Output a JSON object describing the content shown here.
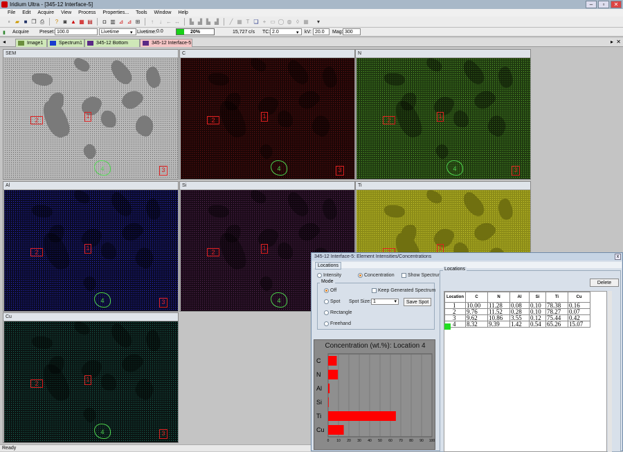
{
  "window": {
    "title": "Iridium Ultra - [345-12 Interface-5]",
    "min": "–",
    "max": "▫",
    "close": "✕"
  },
  "menu": [
    "File",
    "Edit",
    "Acquire",
    "View",
    "Process",
    "Properties...",
    "Tools",
    "Window",
    "Help"
  ],
  "acquire": {
    "acquire_label": "Acquire",
    "preset_label": "Preset:",
    "preset_value": "100.0",
    "mode_value": "Livetime",
    "livetime_label": "Livetime:",
    "livetime_value": "0.0",
    "progress_text": "20%",
    "progress_fraction": 0.2,
    "rate_value": "15,727",
    "rate_unit": "c/s",
    "tc_label": "TC:",
    "tc_value": "2.0",
    "kv_label": "kV:",
    "kv_value": "20.0",
    "mag_label": "Mag:",
    "mag_value": "300"
  },
  "tabs": [
    {
      "label": "Image1",
      "color": "#cfe8b8",
      "icon_color": "#6b8e3d"
    },
    {
      "label": "Spectrum1",
      "color": "#cfe8b8",
      "icon_color": "#1a3ccf"
    },
    {
      "label": "345-12 Bottom Layer",
      "color": "#cfe8b8",
      "icon_color": "#5b2a86"
    },
    {
      "label": "345-12 Interface-5",
      "color": "#f6c6c6",
      "icon_color": "#5b2a86"
    }
  ],
  "panels": [
    {
      "label": "SEM",
      "bg": "#b8b8b8",
      "tint": "#6a6a6a"
    },
    {
      "label": "C",
      "bg": "#1c0606",
      "tint": "#6a1414"
    },
    {
      "label": "N",
      "bg": "#1f3a10",
      "tint": "#58a82c"
    },
    {
      "label": "Al",
      "bg": "#0a0a26",
      "tint": "#2a2ac8"
    },
    {
      "label": "Si",
      "bg": "#1a0a18",
      "tint": "#5a2a58"
    },
    {
      "label": "Ti",
      "bg": "#8c8c18",
      "tint": "#c8c82c"
    },
    {
      "label": "Cu",
      "bg": "#0a1412",
      "tint": "#1a6a5a"
    }
  ],
  "markers": [
    "1",
    "2",
    "3",
    "4"
  ],
  "dialog": {
    "title": "345-12 Interface-5: Element Intensities/Concentrations",
    "close": "x",
    "tab": "Locations",
    "intensity": "Intensity",
    "concentration": "Concentration",
    "show_spectrum": "Show Spectrum",
    "mode": "Mode",
    "off": "Off",
    "keep_generated": "Keep Generated Spectrum",
    "spot": "Spot",
    "spot_size_label": "Spot Size:",
    "spot_size_value": "1",
    "save_spot": "Save Spot",
    "rectangle": "Rectangle",
    "freehand": "Freehand",
    "locations_group": "Locations",
    "delete": "Delete"
  },
  "chart_data": {
    "type": "bar",
    "title": "Concentration (wt.%): Location 4",
    "categories": [
      "C",
      "N",
      "Al",
      "Si",
      "Ti",
      "Cu"
    ],
    "values": [
      8.32,
      9.39,
      1.42,
      0.54,
      65.26,
      15.07
    ],
    "xlim": [
      0,
      100
    ],
    "xticks": [
      "0",
      "10",
      "20",
      "30",
      "40",
      "50",
      "60",
      "70",
      "80",
      "90",
      "100"
    ],
    "bar_color": "#ff0000",
    "grid": true
  },
  "table": {
    "headers": [
      "Location",
      "C",
      "N",
      "Al",
      "Si",
      "Ti",
      "Cu"
    ],
    "rows": [
      [
        "1",
        "10.00",
        "11.28",
        "0.08",
        "0.10",
        "78.38",
        "0.16"
      ],
      [
        "2",
        "9.76",
        "11.52",
        "0.28",
        "0.10",
        "78.27",
        "0.07"
      ],
      [
        "3",
        "9.62",
        "10.86",
        "3.55",
        "0.12",
        "75.44",
        "0.42"
      ],
      [
        "4",
        "8.32",
        "9.39",
        "1.42",
        "0.54",
        "65.26",
        "15.07"
      ]
    ],
    "selected_row": 3,
    "selected_color": "#22dd22"
  },
  "status": "Ready"
}
